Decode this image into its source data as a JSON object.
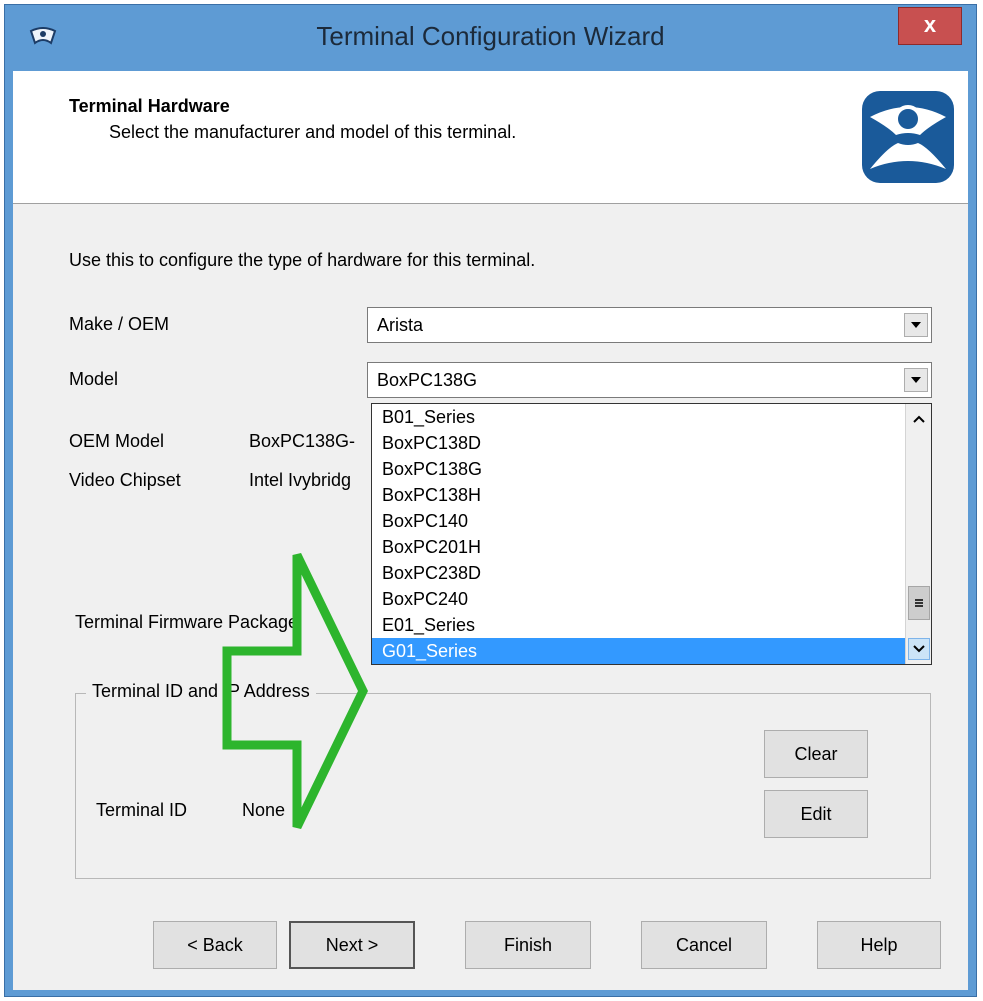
{
  "window": {
    "title": "Terminal Configuration Wizard",
    "close_label": "x"
  },
  "header": {
    "title": "Terminal Hardware",
    "subtitle": "Select the manufacturer and model of this terminal."
  },
  "intro": "Use this to configure the type of hardware for this terminal.",
  "make": {
    "label": "Make / OEM",
    "value": "Arista"
  },
  "model": {
    "label": "Model",
    "value": "BoxPC138G",
    "options": [
      "B01_Series",
      "BoxPC138D",
      "BoxPC138G",
      "BoxPC138H",
      "BoxPC140",
      "BoxPC201H",
      "BoxPC238D",
      "BoxPC240",
      "E01_Series",
      "G01_Series"
    ],
    "highlighted": "G01_Series"
  },
  "oem_model": {
    "label": "OEM Model",
    "value": "BoxPC138G-"
  },
  "video_chipset": {
    "label": "Video Chipset",
    "value": "Intel Ivybridg"
  },
  "firmware": {
    "label": "Terminal Firmware Package"
  },
  "terminal_group": {
    "legend": "Terminal ID and IP Address",
    "id_label": "Terminal ID",
    "id_value": "None",
    "clear_label": "Clear",
    "edit_label": "Edit"
  },
  "buttons": {
    "back": "< Back",
    "next": "Next >",
    "finish": "Finish",
    "cancel": "Cancel",
    "help": "Help"
  },
  "colors": {
    "window_frame": "#5e9bd4",
    "close_button": "#c85050",
    "selection": "#3399ff",
    "annotation_arrow": "#2db52d"
  }
}
